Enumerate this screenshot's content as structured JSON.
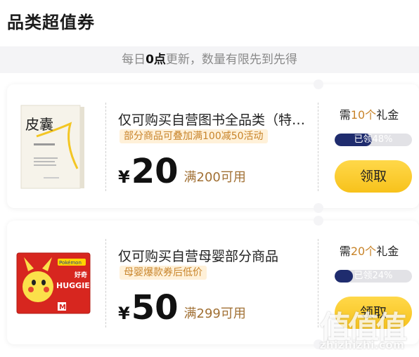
{
  "section_title": "品类超值券",
  "notice": {
    "prefix": "每日",
    "bold": "0点",
    "suffix": "更新，数量有限先到先得"
  },
  "coupons": [
    {
      "name": "仅可购买自营图书全品类（特价书、教材除外）",
      "tag": "部分商品可叠加满100减50活动",
      "currency": "¥",
      "amount": "20",
      "condition": "满200可用",
      "need_prefix": "需",
      "need_value": "10个",
      "need_suffix": "礼金",
      "progress_text": "已领48%",
      "progress": 0.48,
      "button_label": "领取",
      "image_title": "皮囊"
    },
    {
      "name": "仅可购买自营母婴部分商品",
      "tag": "母婴爆款券后低价",
      "currency": "¥",
      "amount": "50",
      "condition": "满299可用",
      "need_prefix": "需",
      "need_value": "20个",
      "need_suffix": "礼金",
      "progress_text": "已领24%",
      "progress": 0.24,
      "button_label": "领取",
      "image_brand": "HUGGIES",
      "image_brand_cn": "好奇",
      "image_badge": "Pokémon"
    }
  ],
  "watermark": {
    "glyphs": "值值值",
    "url": "zhizhizhi.com"
  },
  "colors": {
    "accent": "#c8842a",
    "progress_fill": "#1f2c6e",
    "button": "#f7c21b",
    "notice_bg": "#f4f4f6"
  }
}
